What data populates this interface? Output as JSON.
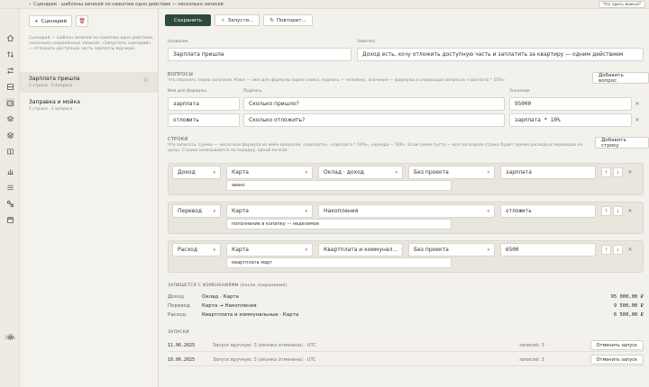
{
  "topbar": {
    "crumb": "Сценарии · шаблоны записей по нажатию одно действие — несколько записей",
    "help": "Что здесь важно?"
  },
  "rail": {
    "icons": [
      "home-icon",
      "arrows-updown-icon",
      "arrows-switch-icon",
      "archive-icon",
      "wallet-icon",
      "stack-icon",
      "layers-icon",
      "book-icon",
      "chart-icon",
      "list-icon",
      "scenario-icon",
      "calendar-icon",
      "settings-icon"
    ],
    "clock": "11:06",
    "clock_sub": "·"
  },
  "sidebar": {
    "new_label": "Сценарий",
    "hint": "Сценарий — шаблон записей по нажатию одно действие, несколько сохранённых записей. «Запустить сценарий» — отложить доступную часть зарплаты вручную.",
    "items": [
      {
        "name": "Зарплата пришла",
        "meta": "2 строки · 2 вопроса",
        "starred": true
      },
      {
        "name": "Заправка и мойка",
        "meta": "2 строки · 2 вопроса",
        "starred": false
      }
    ]
  },
  "toolbar": {
    "save": "Сохранить",
    "run": "Запусти...",
    "repeat": "Повторит..."
  },
  "form": {
    "name_label": "Название",
    "name_value": "Зарплата пришла",
    "note_label": "Заметка",
    "note_value": "Доход есть, хочу отложить доступную часть и заплатить за квартиру — одним действием"
  },
  "questions": {
    "title": "ВОПРОСЫ",
    "desc": "Что спросить перед запуском. Ключ — имя для формулы (одно слово), подпись — человеку, значение — формулы в следующих вопросах «зарплата * 10%»",
    "add": "Добавить вопрос",
    "col_key": "Имя для формулы",
    "col_label": "Подпись",
    "col_value": "Значение",
    "rows": [
      {
        "key": "зарплата",
        "label": "Сколько пришло?",
        "value": "95000"
      },
      {
        "key": "отложить",
        "label": "Сколько отложить?",
        "value": "зарплата * 10%"
      }
    ]
  },
  "lines": {
    "title": "СТРОКИ",
    "desc": "Что записать. Сумма — число или формула из имён вопросов: «зарплата», «зарплата * 10%», «аренда − 500». Если сумма пуста — вся последняя строка будет (кроме расхода и переводов на цель). Строки записываются по порядку, одной пачкой.",
    "add": "Добавить строку",
    "rows": [
      {
        "type": "Доход",
        "account": "Карта",
        "category": "Оклад · доход",
        "project": "Без проекта",
        "amount": "зарплата",
        "memo": "аванс"
      },
      {
        "type": "Перевод",
        "account": "Карта",
        "category": "Накопления",
        "project": "",
        "amount": "отложить",
        "memo": "пополнение в копилку — неделимое"
      },
      {
        "type": "Расход",
        "account": "Карта",
        "category": "Квартплата и коммунал...",
        "project": "Без проекта",
        "amount": "6500",
        "memo": "квартплата март"
      }
    ]
  },
  "totals": {
    "title": "ЗАПИШЕТСЯ С ИЗМЕНЕНИЯМИ (после сохранения)",
    "rows": [
      {
        "type": "Доход",
        "desc": "Оклад · Карта",
        "amount": "95 000,00 ₽"
      },
      {
        "type": "Перевод",
        "desc": "Карта → Накопления",
        "amount": "9 500,00 ₽"
      },
      {
        "type": "Расход",
        "desc": "Квартплата и коммунальные · Карта",
        "amount": "6 500,00 ₽"
      }
    ]
  },
  "runs": {
    "title": "ЗАПУСКИ",
    "rows": [
      {
        "date": "11.06.2025",
        "desc": "Запуск вручную: 3 (иконка отменена) · UTC",
        "count": "записей: 3",
        "cancel": "Отменить запуск"
      },
      {
        "date": "10.06.2025",
        "desc": "Запуск вручную: 3 (иконка отменена) · UTC",
        "count": "записей: 3",
        "cancel": "Отменить запуск"
      }
    ]
  }
}
